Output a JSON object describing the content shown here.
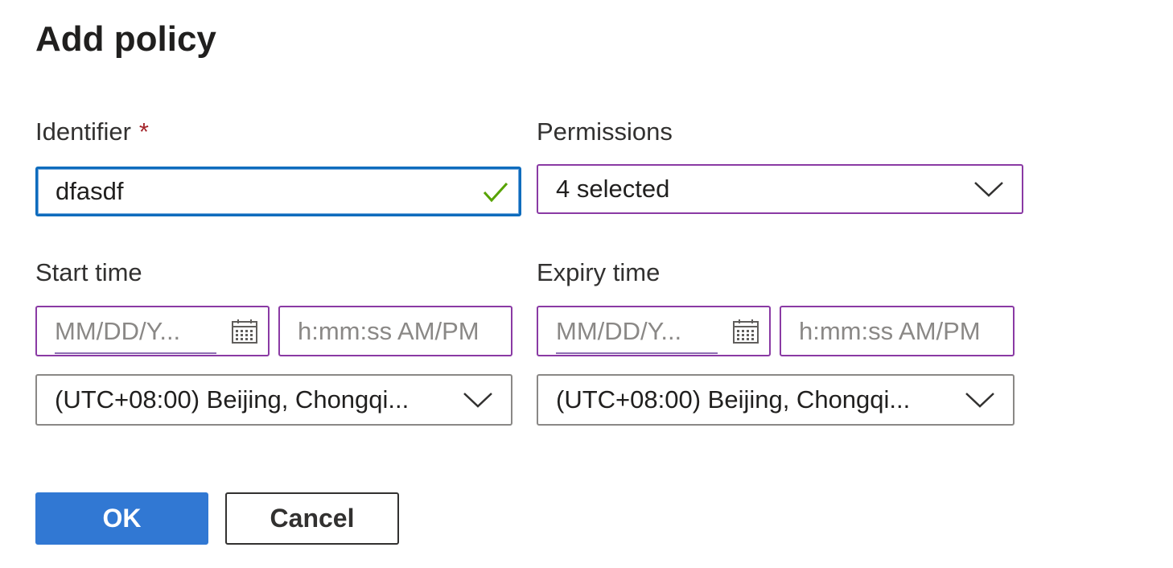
{
  "dialog": {
    "title": "Add policy"
  },
  "identifier": {
    "label": "Identifier",
    "required_marker": "*",
    "value": "dfasdf",
    "valid_icon": "checkmark-icon"
  },
  "permissions": {
    "label": "Permissions",
    "selected_value": "4 selected",
    "dropdown_icon": "chevron-down-icon"
  },
  "start_time": {
    "label": "Start time",
    "date_placeholder": "MM/DD/Y...",
    "time_placeholder": "h:mm:ss AM/PM",
    "timezone": "(UTC+08:00) Beijing, Chongqi...",
    "calendar_icon": "calendar-icon"
  },
  "expiry_time": {
    "label": "Expiry time",
    "date_placeholder": "MM/DD/Y...",
    "time_placeholder": "h:mm:ss AM/PM",
    "timezone": "(UTC+08:00) Beijing, Chongqi...",
    "calendar_icon": "calendar-icon"
  },
  "buttons": {
    "ok_label": "OK",
    "cancel_label": "Cancel"
  },
  "colors": {
    "primary_button": "#3178d3",
    "focused_border": "#0f6cbd",
    "field_border": "#8a3aa4",
    "required_marker": "#a4262c",
    "valid_check": "#57a300"
  }
}
